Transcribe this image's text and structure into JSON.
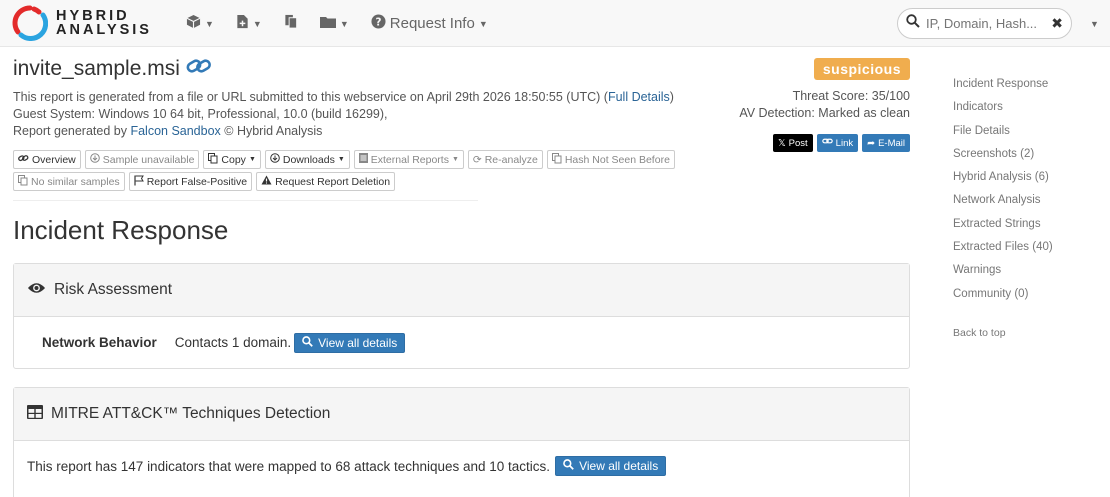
{
  "navbar": {
    "logo_line1": "HYBRID",
    "logo_line2": "ANALYSIS",
    "request_info": "Request Info",
    "search_placeholder": "IP, Domain, Hash..."
  },
  "report": {
    "file_name": "invite_sample.msi",
    "line1_prefix": "This report is generated from a file or URL submitted to this webservice on April 29th 2026 18:50:55 (UTC) (",
    "full_details": "Full Details",
    "line1_suffix": ")",
    "line2": "Guest System: Windows 10 64 bit, Professional, 10.0 (build 16299),",
    "line3_prefix": "Report generated by ",
    "falcon": "Falcon Sandbox",
    "line3_suffix": " © Hybrid Analysis",
    "verdict": "suspicious",
    "threat_score": "Threat Score: 35/100",
    "av_detection": "AV Detection: Marked as clean",
    "share_x": "Post",
    "share_link": "Link",
    "share_mail": "E-Mail"
  },
  "toolbar": {
    "overview": "Overview",
    "sample_unavailable": "Sample unavailable",
    "copy": "Copy",
    "downloads": "Downloads",
    "external_reports": "External Reports",
    "reanalyze": "Re-analyze",
    "hash_not_seen": "Hash Not Seen Before",
    "no_similar": "No similar samples",
    "report_false_positive": "Report False-Positive",
    "request_deletion": "Request Report Deletion"
  },
  "incident": {
    "heading": "Incident Response",
    "risk_title": "Risk Assessment",
    "network_label": "Network Behavior",
    "network_text": "Contacts 1 domain.",
    "view_details": "View all details",
    "mitre_title": "MITRE ATT&CK™ Techniques Detection",
    "mitre_text": "This report has 147 indicators that were mapped to 68 attack techniques and 10 tactics.",
    "mitre_view": "View all details"
  },
  "sidebar": {
    "items": [
      "Incident Response",
      "Indicators",
      "File Details",
      "Screenshots (2)",
      "Hybrid Analysis (6)",
      "Network Analysis",
      "Extracted Strings",
      "Extracted Files (40)",
      "Warnings",
      "Community (0)"
    ],
    "back_to_top": "Back to top"
  },
  "colors": {
    "suspicious": "#f0ad4e",
    "primary": "#337ab7",
    "logo_red": "#e32b2b",
    "logo_blue": "#2ba4e0"
  }
}
